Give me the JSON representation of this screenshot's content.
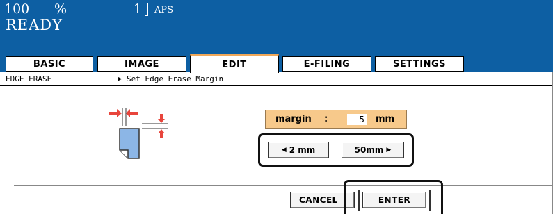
{
  "status": {
    "zoom": "100",
    "zoom_unit": "%",
    "copies": "1",
    "paper_mode": "APS",
    "state": "READY"
  },
  "tabs": [
    {
      "label": "BASIC",
      "active": false
    },
    {
      "label": "IMAGE",
      "active": false
    },
    {
      "label": "EDIT",
      "active": true
    },
    {
      "label": "E-FILING",
      "active": false
    },
    {
      "label": "SETTINGS",
      "active": false
    }
  ],
  "section": {
    "title": "EDGE ERASE",
    "instruction": "Set Edge Erase Margin",
    "instruction_marker": "▶"
  },
  "margin": {
    "label": "margin",
    "colon": ":",
    "value": "5",
    "unit": "mm"
  },
  "range_buttons": {
    "min_label": "2 mm",
    "min_arrow": "◀",
    "max_label": "50mm",
    "max_arrow": "▶"
  },
  "actions": {
    "cancel_label": "CANCEL",
    "enter_label": "ENTER"
  },
  "colors": {
    "header_bg": "#0d5fa3",
    "tab_active_accent": "#f0a85a",
    "margin_box": "#f7c98b",
    "arrow_red": "#e8453c",
    "page_blue": "#8cb6e6"
  },
  "icons": {
    "edge_erase": "edge-erase-diagram-icon"
  }
}
